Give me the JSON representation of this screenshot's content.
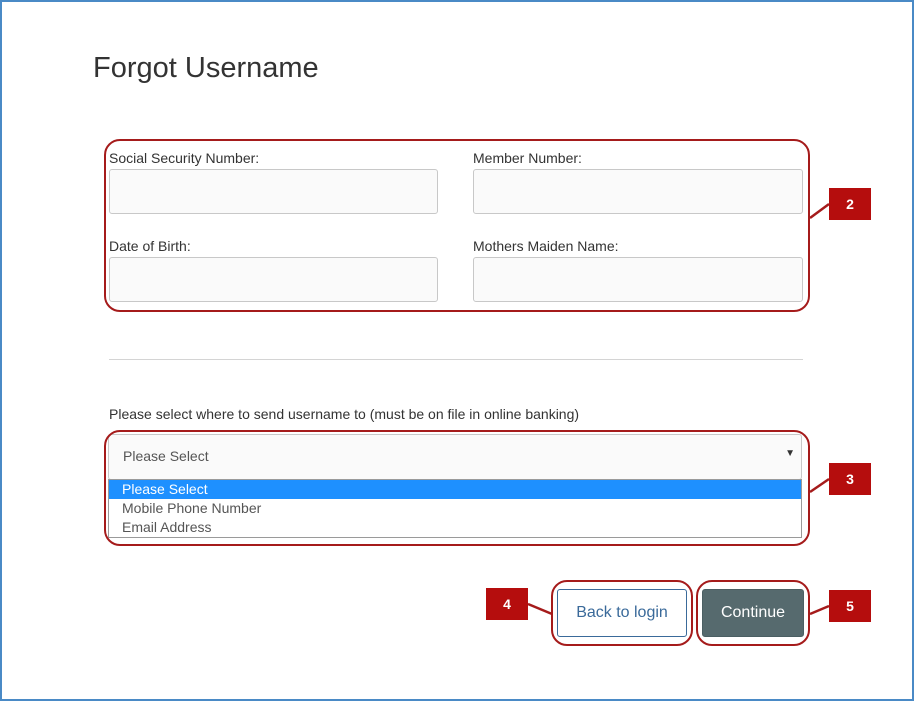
{
  "page": {
    "title": "Forgot Username"
  },
  "form": {
    "ssn_label": "Social Security Number:",
    "member_label": "Member Number:",
    "dob_label": "Date of Birth:",
    "maiden_label": "Mothers Maiden Name:",
    "ssn_value": "",
    "member_value": "",
    "dob_value": "",
    "maiden_value": ""
  },
  "delivery": {
    "prompt": "Please select where to send username to (must be on file in online banking)",
    "selected": "Please Select",
    "options": [
      "Please Select",
      "Mobile Phone Number",
      "Email Address"
    ]
  },
  "buttons": {
    "back_label": "Back to login",
    "continue_label": "Continue"
  },
  "callouts": [
    "2",
    "3",
    "4",
    "5"
  ],
  "colors": {
    "callout_red": "#b50d0d",
    "highlight_blue": "#1e90ff",
    "continue_bg": "#566a6e"
  }
}
